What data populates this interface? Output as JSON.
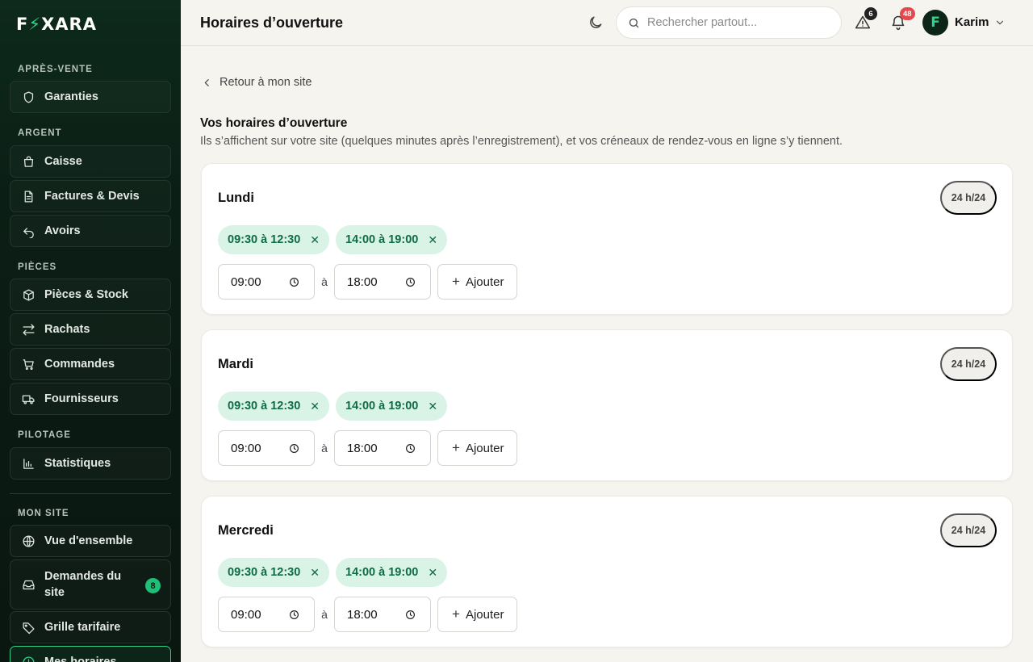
{
  "brand": {
    "logo_left": "F",
    "logo_bolt": "⚡",
    "logo_right": "XARA"
  },
  "sidebar": {
    "sections": [
      {
        "label": "APRÈS-VENTE"
      },
      {
        "label": "ARGENT"
      },
      {
        "label": "PIÈCES"
      },
      {
        "label": "PILOTAGE"
      },
      {
        "label": "MON SITE"
      }
    ],
    "items": [
      {
        "label": "Garanties",
        "icon": "shield-icon"
      },
      {
        "label": "Caisse",
        "icon": "cash-register-icon"
      },
      {
        "label": "Factures & Devis",
        "icon": "document-icon"
      },
      {
        "label": "Avoirs",
        "icon": "undo-icon"
      },
      {
        "label": "Pièces & Stock",
        "icon": "box-icon"
      },
      {
        "label": "Rachats",
        "icon": "swap-icon"
      },
      {
        "label": "Commandes",
        "icon": "cart-icon"
      },
      {
        "label": "Fournisseurs",
        "icon": "truck-icon"
      },
      {
        "label": "Statistiques",
        "icon": "bar-chart-icon"
      },
      {
        "label": "Vue d'ensemble",
        "icon": "globe-icon"
      },
      {
        "label": "Demandes du site",
        "icon": "inbox-icon",
        "badge": "8"
      },
      {
        "label": "Grille tarifaire",
        "icon": "tag-icon"
      },
      {
        "label": "Mes horaires",
        "icon": "clock-icon",
        "active": true
      }
    ]
  },
  "topbar": {
    "title": "Horaires d’ouverture",
    "search_placeholder": "Rechercher partout...",
    "alerts_count": "6",
    "notifications_count": "48",
    "user_initial": "F",
    "user_name": "Karim"
  },
  "main": {
    "back_label": "Retour à mon site",
    "heading": "Vos horaires d’ouverture",
    "description": "Ils s’affichent sur votre site (quelques minutes après l’enregistrement), et vos créneaux de rendez-vous en ligne s’y tiennent.",
    "days": [
      {
        "name": "Lundi",
        "badge": "24 h/24",
        "slots": [
          "09:30 à 12:30",
          "14:00 à 19:00"
        ],
        "from": "09:00",
        "sep": "à",
        "to": "18:00",
        "add_label": "Ajouter"
      },
      {
        "name": "Mardi",
        "badge": "24 h/24",
        "slots": [
          "09:30 à 12:30",
          "14:00 à 19:00"
        ],
        "from": "09:00",
        "sep": "à",
        "to": "18:00",
        "add_label": "Ajouter"
      },
      {
        "name": "Mercredi",
        "badge": "24 h/24",
        "slots": [
          "09:30 à 12:30",
          "14:00 à 19:00"
        ],
        "from": "09:00",
        "sep": "à",
        "to": "18:00",
        "add_label": "Ajouter"
      }
    ]
  },
  "colors": {
    "accent": "#2fd38a",
    "sidebar_bg": "#0b1e15",
    "slot_bg": "#d9f3e6",
    "slot_text": "#0f6b45",
    "alert_badge": "#222222",
    "notif_badge": "#e5484d"
  }
}
